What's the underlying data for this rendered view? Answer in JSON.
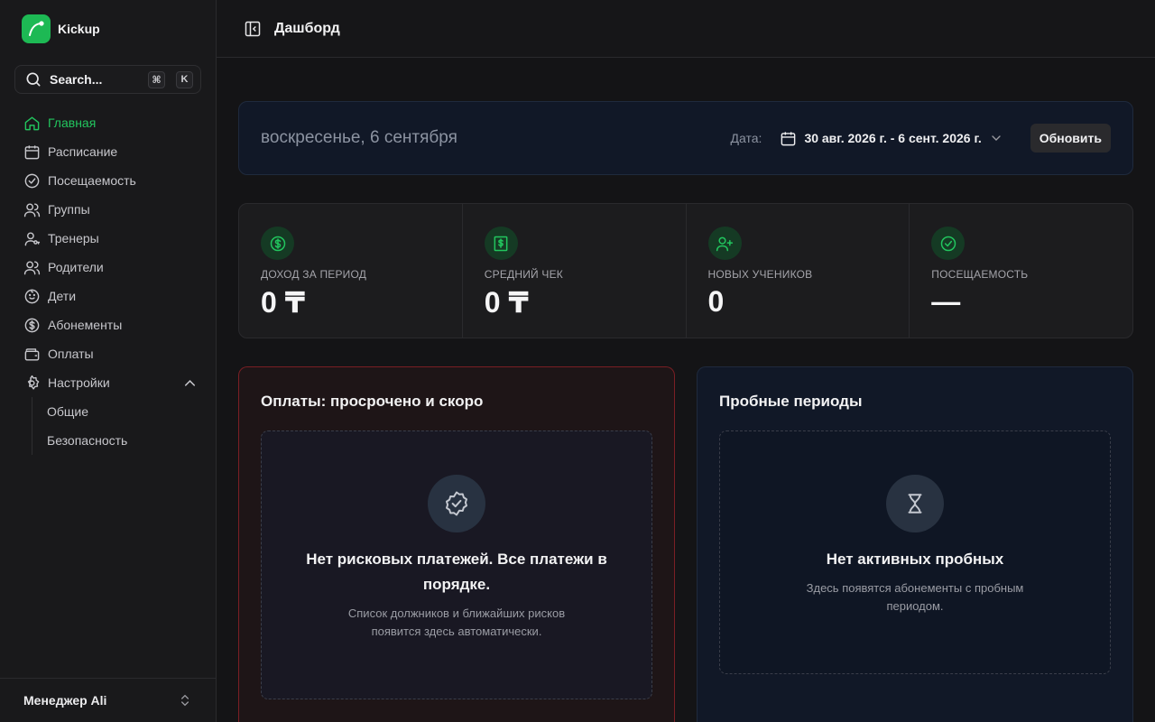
{
  "app": {
    "name": "Kickup"
  },
  "search": {
    "label": "Search...",
    "shortcut_mod": "⌘",
    "shortcut_key": "K"
  },
  "sidebar": {
    "items": [
      {
        "label": "Главная",
        "icon": "home-icon",
        "active": true
      },
      {
        "label": "Расписание",
        "icon": "calendar-icon"
      },
      {
        "label": "Посещаемость",
        "icon": "check-circle-icon"
      },
      {
        "label": "Группы",
        "icon": "users-icon"
      },
      {
        "label": "Тренеры",
        "icon": "user-key-icon"
      },
      {
        "label": "Родители",
        "icon": "users-icon"
      },
      {
        "label": "Дети",
        "icon": "baby-icon"
      },
      {
        "label": "Абонементы",
        "icon": "dollar-circle-icon"
      },
      {
        "label": "Оплаты",
        "icon": "wallet-icon"
      },
      {
        "label": "Настройки",
        "icon": "gear-icon",
        "expanded": true
      }
    ],
    "settings_sub": [
      {
        "label": "Общие"
      },
      {
        "label": "Безопасность"
      }
    ],
    "footer_user": "Менеджер Ali"
  },
  "header": {
    "title": "Дашборд"
  },
  "datebar": {
    "today": "воскресенье, 6 сентября",
    "date_label": "Дата:",
    "range": "30 авг. 2026 г. - 6 сент. 2026 г.",
    "refresh_label": "Обновить"
  },
  "stats": [
    {
      "label": "ДОХОД ЗА ПЕРИОД",
      "value": "0 ₸",
      "icon": "dollar-circle-icon"
    },
    {
      "label": "СРЕДНИЙ ЧЕК",
      "value": "0 ₸",
      "icon": "receipt-icon"
    },
    {
      "label": "НОВЫХ УЧЕНИКОВ",
      "value": "0",
      "icon": "user-plus-icon"
    },
    {
      "label": "ПОСЕЩАЕМОСТЬ",
      "value": "—",
      "icon": "check-circle-icon"
    }
  ],
  "panels": {
    "payments": {
      "title": "Оплаты: просрочено и скоро",
      "empty_title": "Нет рисковых платежей. Все платежи в порядке.",
      "empty_sub": "Список должников и ближайших рисков появится здесь автоматически."
    },
    "trials": {
      "title": "Пробные периоды",
      "empty_title": "Нет активных пробных",
      "empty_sub": "Здесь появятся абонементы с пробным периодом."
    }
  },
  "colors": {
    "accent": "#22c55e",
    "background": "#141416",
    "danger_border": "#7a1f24",
    "panel_blue": "#111827"
  }
}
